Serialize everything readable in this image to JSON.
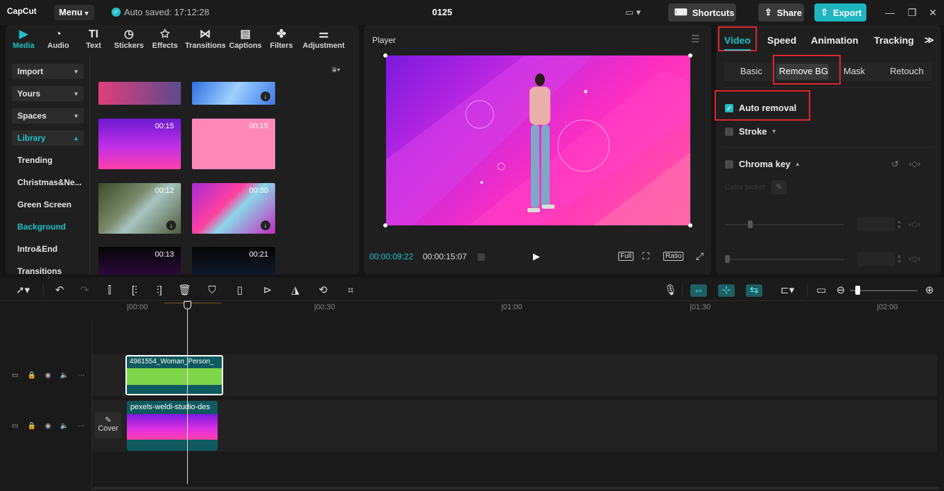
{
  "app": {
    "logo": "CapCut",
    "menu_label": "Menu",
    "autosave": "Auto saved: 17:12:28",
    "project_title": "0125",
    "shortcuts_label": "Shortcuts",
    "share_label": "Share",
    "export_label": "Export"
  },
  "media_tabs": [
    {
      "label": "Media",
      "icon": "media-icon"
    },
    {
      "label": "Audio",
      "icon": "audio-icon"
    },
    {
      "label": "Text",
      "icon": "text-icon"
    },
    {
      "label": "Stickers",
      "icon": "stickers-icon"
    },
    {
      "label": "Effects",
      "icon": "effects-icon"
    },
    {
      "label": "Transitions",
      "icon": "transitions-icon"
    },
    {
      "label": "Captions",
      "icon": "captions-icon"
    },
    {
      "label": "Filters",
      "icon": "filters-icon"
    },
    {
      "label": "Adjustment",
      "icon": "adjustment-icon"
    }
  ],
  "sidebar": {
    "buttons": [
      "Import",
      "Yours",
      "Spaces",
      "Library"
    ],
    "items": [
      "Trending",
      "Christmas&Ne...",
      "Green Screen",
      "Background",
      "Intro&End",
      "Transitions"
    ]
  },
  "media_grid": {
    "durations": [
      "00:15",
      "00:15",
      "00:12",
      "00:30",
      "00:13",
      "00:21"
    ]
  },
  "player": {
    "title": "Player",
    "current_time": "00:00:09:22",
    "total_time": "00:00:15:07",
    "full_label": "Full",
    "ratio_label": "Ratio"
  },
  "right_panel": {
    "tabs": [
      "Video",
      "Speed",
      "Animation",
      "Tracking"
    ],
    "subtabs": [
      "Basic",
      "Remove BG",
      "Mask",
      "Retouch"
    ],
    "auto_removal": "Auto removal",
    "stroke": "Stroke",
    "chroma_key": "Chroma key",
    "color_picker": "Color picker"
  },
  "timeline": {
    "ticks": [
      "00:00",
      "00:30",
      "01:00",
      "01:30",
      "02:00"
    ],
    "clip1_name": "4961554_Woman_Person_",
    "clip2_name": "pexels-weldi-studio-des",
    "cover_label": "Cover"
  },
  "colors": {
    "accent": "#22c0c8",
    "highlight": "#e0252f",
    "panel": "#1f1f1f",
    "background": "#141414"
  }
}
